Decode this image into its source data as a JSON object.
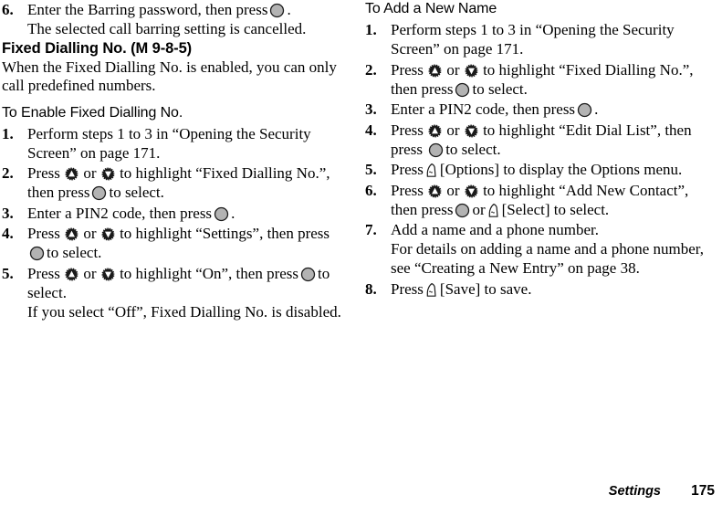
{
  "document": {
    "footer": {
      "section_label": "Settings",
      "page_number": "175"
    }
  },
  "icons": {
    "nav_up": "navigation-up-key-icon",
    "nav_down": "navigation-down-key-icon",
    "center_select": "center-select-key-icon",
    "soft_key": "left-soft-key-icon"
  },
  "colors": {
    "text": "#000000",
    "page_background": "#ffffff",
    "key_fill": "#b3b3b3",
    "key_dark": "#1a1a1a"
  },
  "left_column": {
    "step6": {
      "number": "6.",
      "text_a": "Enter the Barring password, then press",
      "text_b": ".",
      "note": "The selected call barring setting is cancelled."
    },
    "section_heading": "Fixed Dialling No. (M 9-8-5)",
    "intro_paragraph": "When the Fixed Dialling No. is enabled, you can only call predefined numbers.",
    "sub_heading": "To Enable Fixed Dialling No.",
    "steps": [
      {
        "number": "1.",
        "text_a": "Perform steps 1 to 3 in “Opening the Security Screen” on page 171.",
        "text_b": "",
        "text_c": ""
      },
      {
        "number": "2.",
        "text_a": "Press",
        "text_b": "or",
        "text_c": "to highlight “Fixed Dialling No.”, then press",
        "text_d": "to select."
      },
      {
        "number": "3.",
        "text_a": "Enter a PIN2 code, then press",
        "text_b": "."
      },
      {
        "number": "4.",
        "text_a": "Press",
        "text_b": "or",
        "text_c": "to highlight “Settings”, then press",
        "text_d": "to select."
      },
      {
        "number": "5.",
        "text_a": "Press",
        "text_b": "or",
        "text_c": "to highlight “On”, then press",
        "text_d": "to select.",
        "note": "If you select “Off”, Fixed Dialling No. is disabled."
      }
    ]
  },
  "right_column": {
    "sub_heading": "To Add a New Name",
    "steps": [
      {
        "number": "1.",
        "text_a": "Perform steps 1 to 3 in “Opening the Security Screen” on page 171."
      },
      {
        "number": "2.",
        "text_a": "Press",
        "text_b": "or",
        "text_c": "to highlight “Fixed Dialling No.”, then press",
        "text_d": "to select."
      },
      {
        "number": "3.",
        "text_a": "Enter a PIN2 code, then press",
        "text_b": "."
      },
      {
        "number": "4.",
        "text_a": "Press",
        "text_b": "or",
        "text_c": "to highlight “Edit Dial List”, then press",
        "text_d": "to select."
      },
      {
        "number": "5.",
        "text_a": "Press",
        "text_b": "[Options] to display the Options menu."
      },
      {
        "number": "6.",
        "text_a": "Press",
        "text_b": "or",
        "text_c": "to highlight “Add New Contact”, then press",
        "text_d": "or",
        "text_e": "[Select] to select."
      },
      {
        "number": "7.",
        "text_a": "Add a name and a phone number.",
        "note": "For details on adding a name and a phone number, see “Creating a New Entry” on page 38."
      },
      {
        "number": "8.",
        "text_a": "Press",
        "text_b": "[Save] to save."
      }
    ]
  }
}
